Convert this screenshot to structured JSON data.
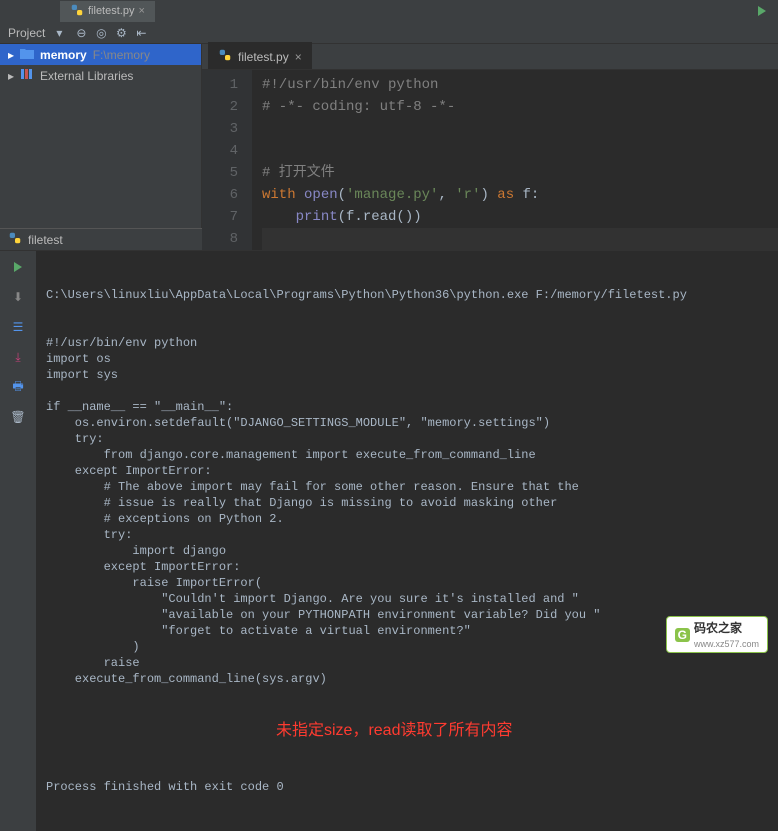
{
  "topTab": {
    "label": "filetest.py"
  },
  "toolbar": {
    "label": "Project"
  },
  "sidebar": {
    "items": [
      {
        "name": "memory",
        "path": "F:\\memory"
      },
      {
        "name": "External Libraries"
      }
    ]
  },
  "editor": {
    "tab": {
      "label": "filetest.py"
    },
    "lines": [
      {
        "n": "1",
        "tokens": [
          {
            "t": "#!/usr/bin/env python",
            "c": "c-comment"
          }
        ]
      },
      {
        "n": "2",
        "tokens": [
          {
            "t": "# -*- coding: utf-8 -*-",
            "c": "c-comment"
          }
        ]
      },
      {
        "n": "3",
        "tokens": []
      },
      {
        "n": "4",
        "tokens": []
      },
      {
        "n": "5",
        "tokens": [
          {
            "t": "# 打开文件",
            "c": "c-comment"
          }
        ]
      },
      {
        "n": "6",
        "tokens": [
          {
            "t": "with ",
            "c": "c-keyword"
          },
          {
            "t": "open",
            "c": "c-builtin"
          },
          {
            "t": "(",
            "c": "c-default"
          },
          {
            "t": "'manage.py'",
            "c": "c-string"
          },
          {
            "t": ", ",
            "c": "c-default"
          },
          {
            "t": "'r'",
            "c": "c-string"
          },
          {
            "t": ") ",
            "c": "c-default"
          },
          {
            "t": "as ",
            "c": "c-keyword"
          },
          {
            "t": "f:",
            "c": "c-default"
          }
        ]
      },
      {
        "n": "7",
        "tokens": [
          {
            "t": "    ",
            "c": "c-default"
          },
          {
            "t": "print",
            "c": "c-builtin"
          },
          {
            "t": "(f.read())",
            "c": "c-default"
          }
        ]
      },
      {
        "n": "8",
        "tokens": [],
        "cursor": true
      }
    ]
  },
  "run": {
    "title": "filetest",
    "cmdline": "C:\\Users\\linuxliu\\AppData\\Local\\Programs\\Python\\Python36\\python.exe F:/memory/filetest.py",
    "output": "#!/usr/bin/env python\nimport os\nimport sys\n\nif __name__ == \"__main__\":\n    os.environ.setdefault(\"DJANGO_SETTINGS_MODULE\", \"memory.settings\")\n    try:\n        from django.core.management import execute_from_command_line\n    except ImportError:\n        # The above import may fail for some other reason. Ensure that the\n        # issue is really that Django is missing to avoid masking other\n        # exceptions on Python 2.\n        try:\n            import django\n        except ImportError:\n            raise ImportError(\n                \"Couldn't import Django. Are you sure it's installed and \"\n                \"available on your PYTHONPATH environment variable? Did you \"\n                \"forget to activate a virtual environment?\"\n            )\n        raise\n    execute_from_command_line(sys.argv)\n",
    "annotation": "未指定size，read读取了所有内容",
    "exitMsg": "Process finished with exit code 0"
  },
  "watermark": {
    "text": "码农之家",
    "sub": "www.xz577.com"
  }
}
